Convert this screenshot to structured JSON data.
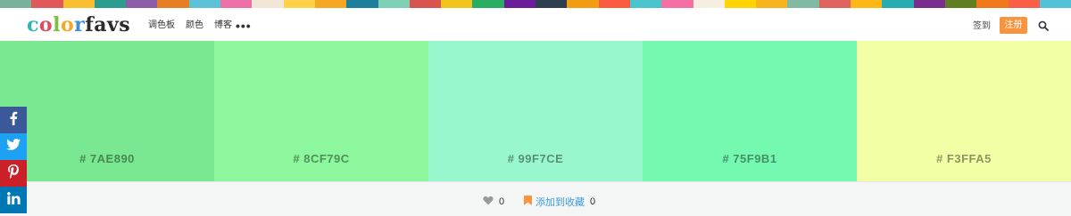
{
  "top_strip_colors": [
    "#79b29a",
    "#e05858",
    "#f8c030",
    "#2a9d8f",
    "#8e5ba8",
    "#e77e23",
    "#5bc2d8",
    "#ee6fa6",
    "#f2e7d6",
    "#ffd24a",
    "#f5a623",
    "#1e7f9c",
    "#7dcfb6",
    "#d9534f",
    "#f0c419",
    "#27ae60",
    "#6a1b9a",
    "#2c3e50",
    "#f39c12",
    "#fb5b3f",
    "#4ac5cd",
    "#f56ea4",
    "#f6eee1",
    "#ffd400",
    "#f8b31d",
    "#81b9a3",
    "#e0625e",
    "#ffb716",
    "#25aeb1",
    "#7a2c8f",
    "#5f7f22",
    "#f2771a",
    "#fa5e46",
    "#52c3d6"
  ],
  "nav": {
    "logo_letters": [
      {
        "ch": "c",
        "color": "#2fb6b0"
      },
      {
        "ch": "o",
        "color": "#e24b5b"
      },
      {
        "ch": "l",
        "color": "#7bbf3f"
      },
      {
        "ch": "o",
        "color": "#f5a623"
      },
      {
        "ch": "r",
        "color": "#3d8fd6"
      },
      {
        "ch": "f",
        "color": "#2b2b2b"
      },
      {
        "ch": "a",
        "color": "#2b2b2b"
      },
      {
        "ch": "v",
        "color": "#2b2b2b"
      },
      {
        "ch": "s",
        "color": "#2b2b2b"
      }
    ],
    "link_palettes": "调色板",
    "link_colors": "颜色",
    "link_blog": "博客",
    "more": "•••",
    "login": "签到",
    "register": "注册",
    "search_icon": "search-icon"
  },
  "swatches": [
    {
      "hex": "#7AE890",
      "label": "# 7AE890"
    },
    {
      "hex": "#8CF79C",
      "label": "# 8CF79C"
    },
    {
      "hex": "#99F7CE",
      "label": "# 99F7CE"
    },
    {
      "hex": "#75F9B1",
      "label": "# 75F9B1"
    },
    {
      "hex": "#F3FFA5",
      "label": "# F3FFA5"
    }
  ],
  "footer": {
    "like_icon": "heart-icon",
    "like_count": "0",
    "favorite_icon": "bookmark-icon",
    "favorite_label": "添加到收藏",
    "favorite_count": "0"
  },
  "social": [
    {
      "name": "facebook",
      "color": "#3b5998",
      "icon": "facebook-icon"
    },
    {
      "name": "twitter",
      "color": "#1da1f2",
      "icon": "twitter-icon"
    },
    {
      "name": "pinterest",
      "color": "#cb2027",
      "icon": "pinterest-icon"
    },
    {
      "name": "linkedin",
      "color": "#0077b5",
      "icon": "linkedin-icon"
    }
  ]
}
